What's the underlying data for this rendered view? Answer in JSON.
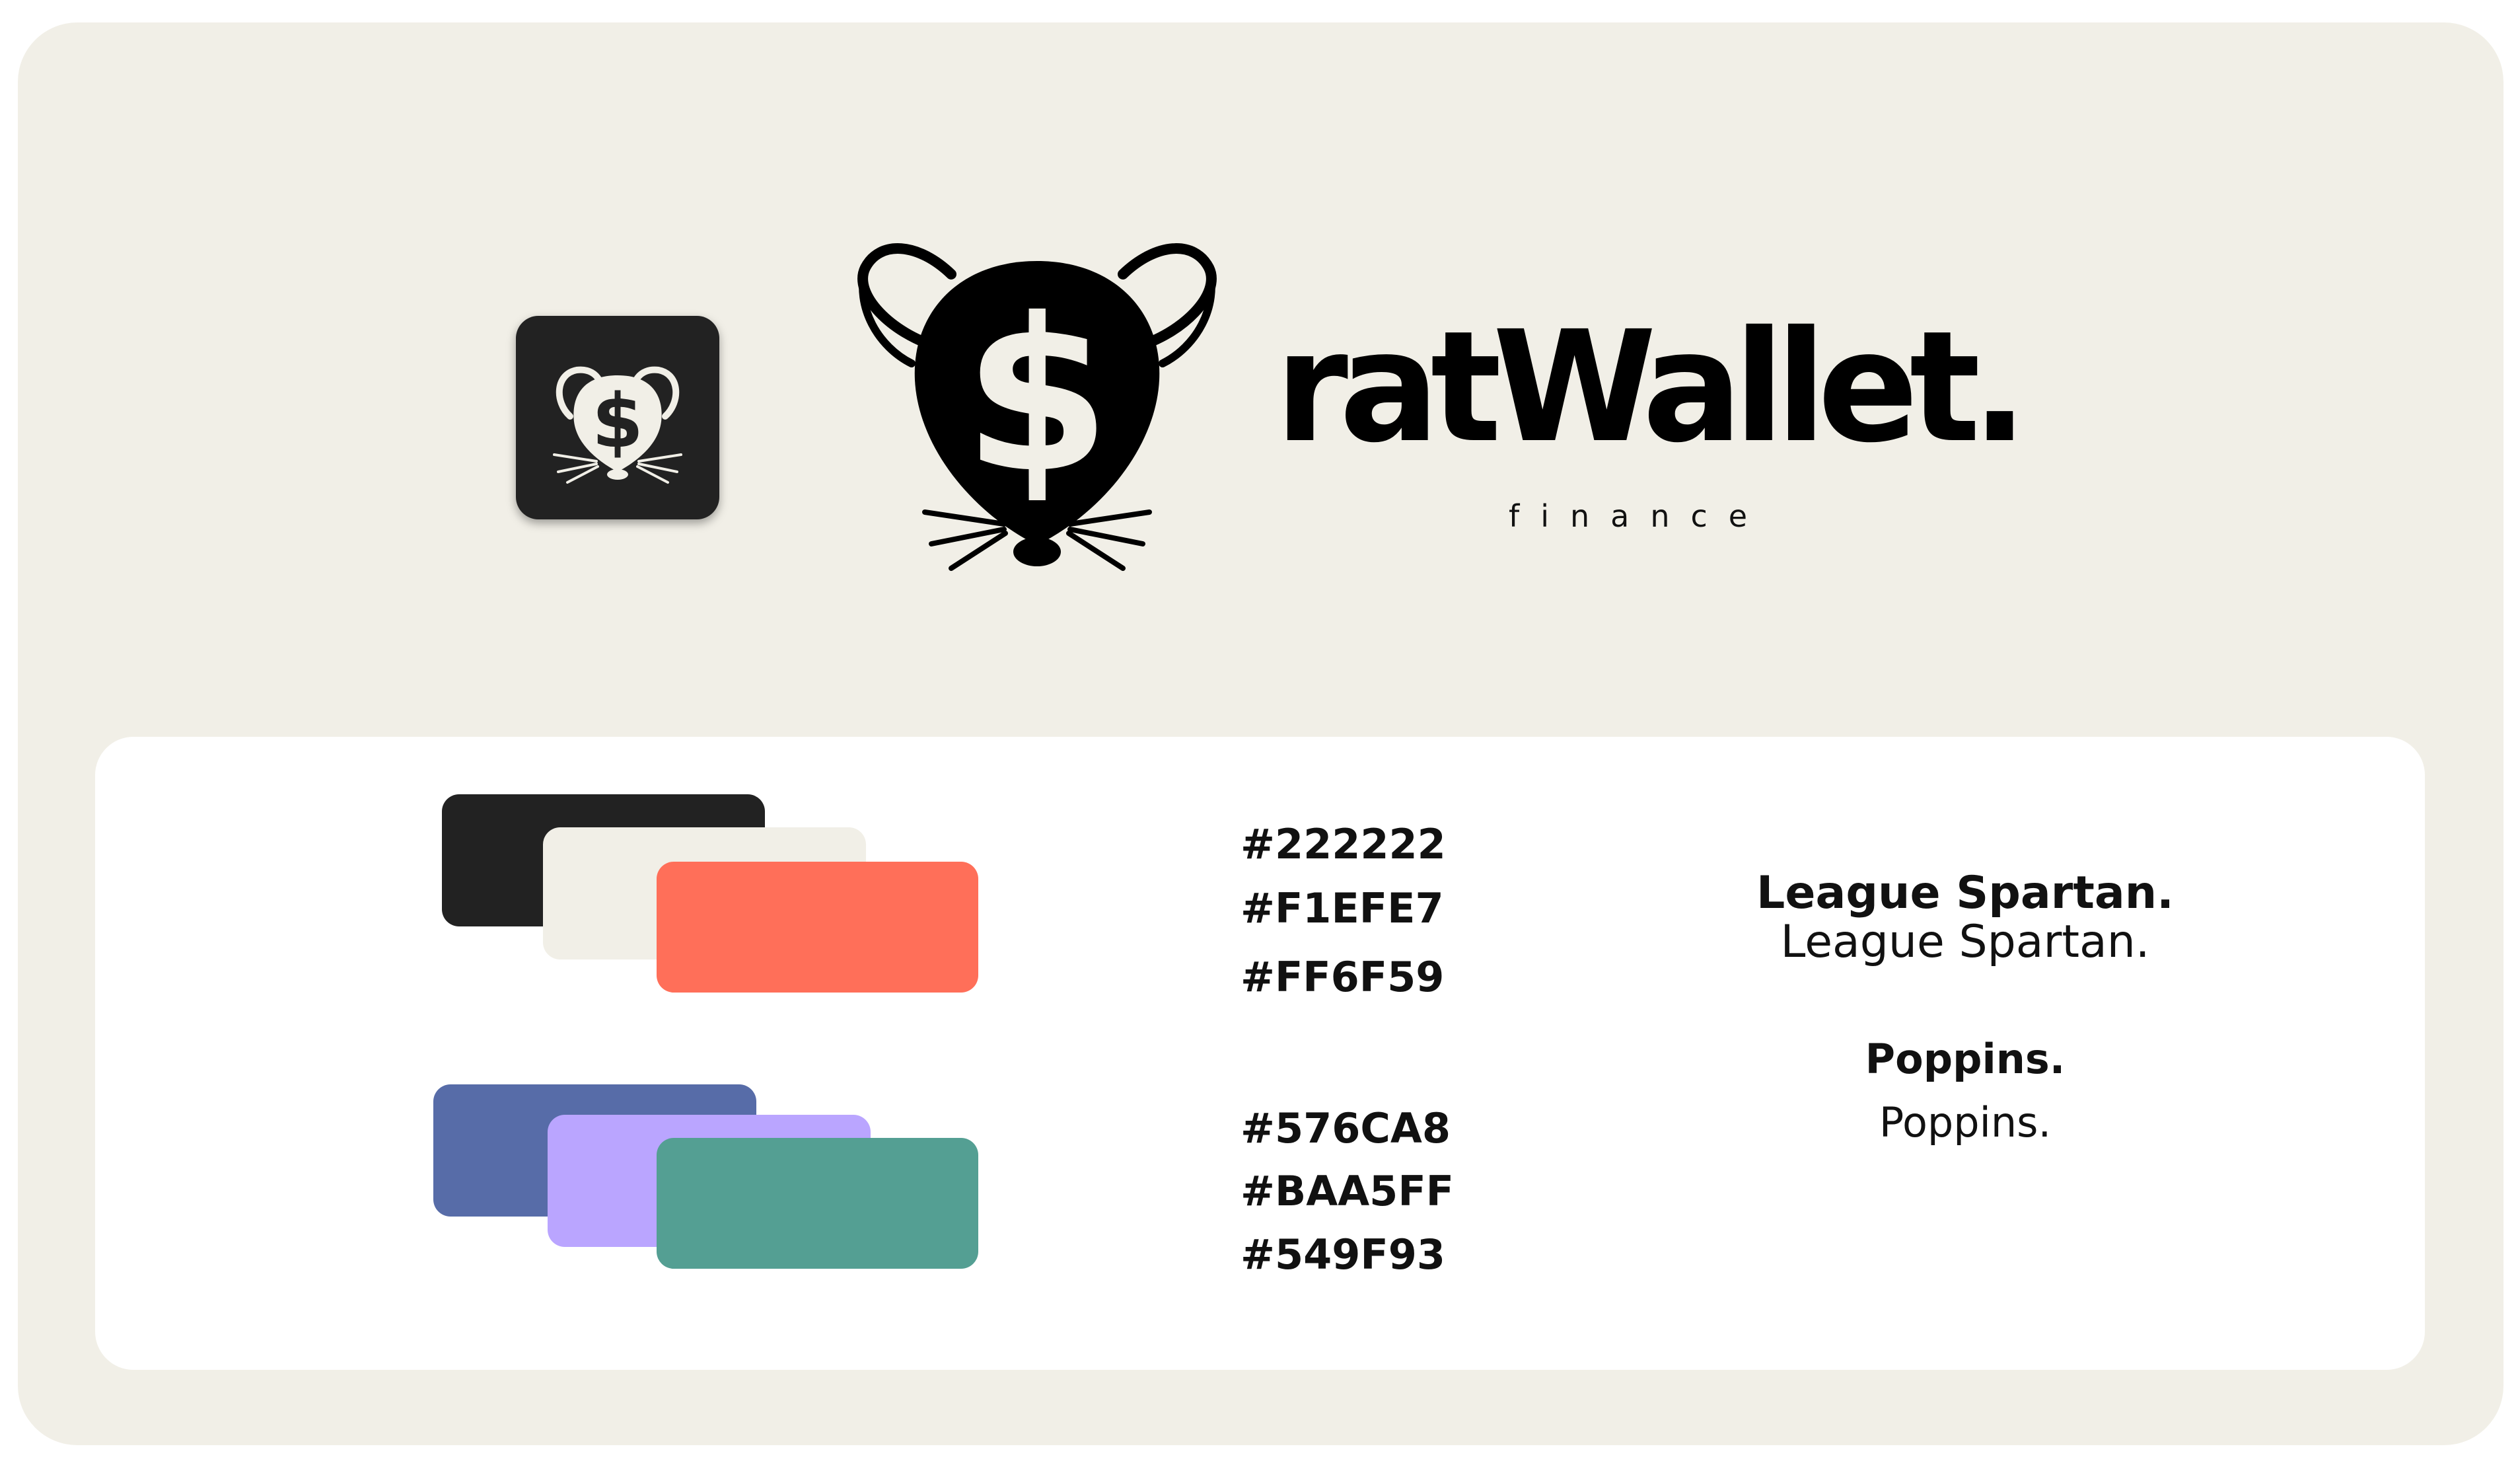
{
  "brand": {
    "name": "ratWallet.",
    "tagline": "finance",
    "logo_icon": "rat-dollar-icon"
  },
  "palette": {
    "primary": [
      {
        "hex_label": "#222222",
        "color": "#222222"
      },
      {
        "hex_label": "#F1EFE7",
        "color": "#F1EFE7"
      },
      {
        "hex_label": "#FF6F59",
        "color": "#FF6F59"
      }
    ],
    "secondary": [
      {
        "hex_label": "#576CA8",
        "color": "#576CA8"
      },
      {
        "hex_label": "#BAA5FF",
        "color": "#BAA5FF"
      },
      {
        "hex_label": "#549F93",
        "color": "#549F93"
      }
    ]
  },
  "typography": {
    "heading_bold": "League Spartan.",
    "heading_regular": "League Spartan.",
    "body_bold": "Poppins.",
    "body_regular": "Poppins."
  }
}
